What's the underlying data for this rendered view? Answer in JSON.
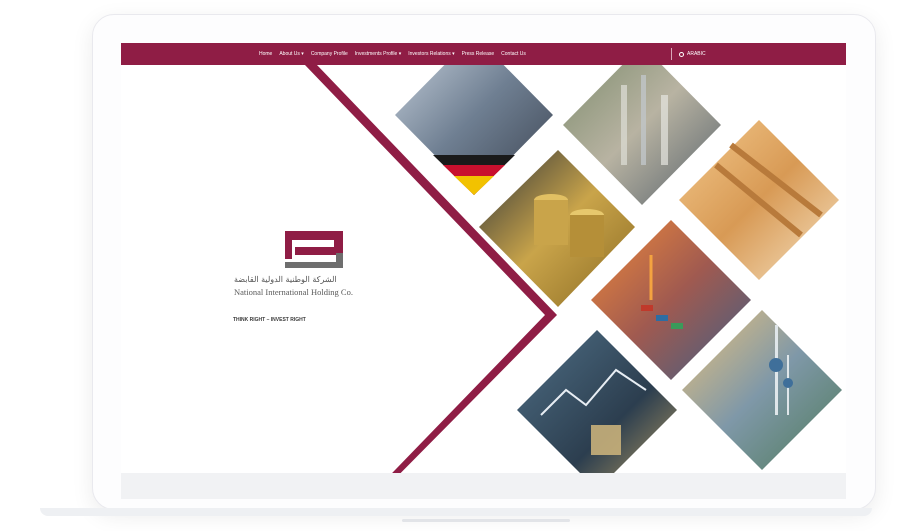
{
  "nav": {
    "items": [
      "Home",
      "About Us ▾",
      "Company Profile",
      "Investments Profile ▾",
      "Investors Relations ▾",
      "Press Release",
      "Contact Us"
    ],
    "language": "ARABIC"
  },
  "brand": {
    "name_ar": "الشركة الوطنية الدولية القابضة",
    "name_en": "National International Holding Co.",
    "tagline": "THINK RIGHT  –  INVEST RIGHT"
  },
  "colors": {
    "accent": "#8f1d45",
    "logo_gray": "#6e6e6e"
  },
  "gallery": [
    "machinery-photo",
    "refinery-photo",
    "gold-coins-photo",
    "timber-frame-photo",
    "shipping-port-photo",
    "finance-chart-photo",
    "kuwait-towers-photo"
  ]
}
